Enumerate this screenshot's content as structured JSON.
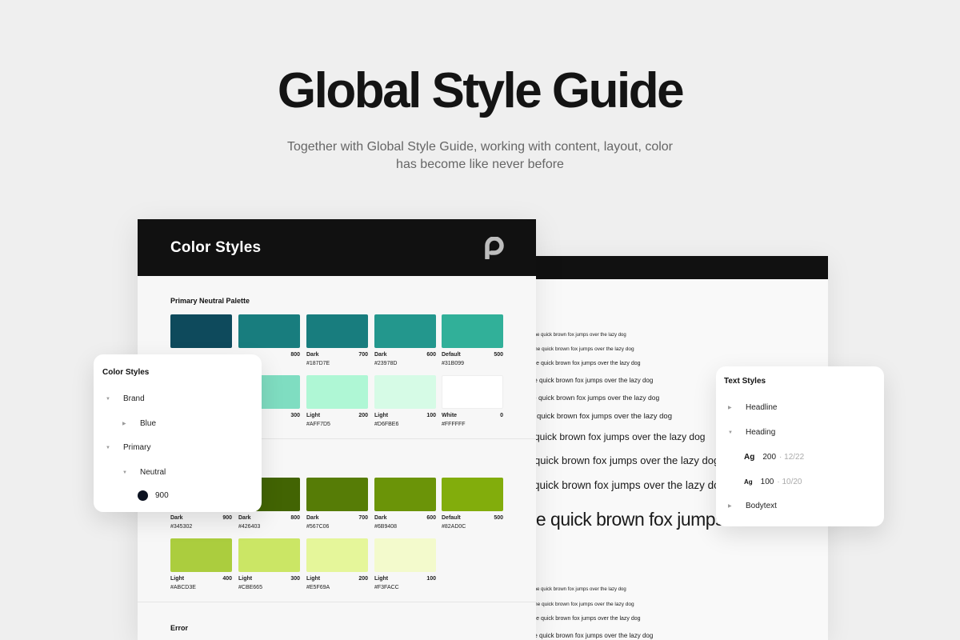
{
  "hero": {
    "title": "Global Style Guide",
    "subtitle_line1": "Together with Global Style Guide, working with content, layout, color",
    "subtitle_line2": "has become like never before"
  },
  "color_doc": {
    "title": "Color Styles",
    "logo_icon": "p-logo-icon",
    "primary_section": "Primary Neutral Palette",
    "error_section": "Error",
    "neutral_row1": [
      {
        "color": "#0E4A5C",
        "label": "",
        "weight": "",
        "hex": ""
      },
      {
        "color": "#187D7E",
        "label": "",
        "weight": "800",
        "hex": ""
      },
      {
        "color": "#187D7E",
        "label": "Dark",
        "weight": "700",
        "hex": "#187D7E"
      },
      {
        "color": "#23978D",
        "label": "Dark",
        "weight": "600",
        "hex": "#23978D"
      },
      {
        "color": "#31B099",
        "label": "Default",
        "weight": "500",
        "hex": "#31B099"
      }
    ],
    "neutral_row2": [
      {
        "color": "#7FDDC1",
        "label": "",
        "weight": "300",
        "hex": ""
      },
      {
        "color": "#AFF7D5",
        "label": "Light",
        "weight": "200",
        "hex": "#AFF7D5"
      },
      {
        "color": "#D6FBE6",
        "label": "Light",
        "weight": "100",
        "hex": "#D6FBE6"
      },
      {
        "color": "#FFFFFF",
        "label": "White",
        "weight": "0",
        "hex": "#FFFFFF"
      }
    ],
    "green_row1": [
      {
        "color": "#345302",
        "label": "Dark",
        "weight": "900",
        "hex": "#345302"
      },
      {
        "color": "#426403",
        "label": "Dark",
        "weight": "800",
        "hex": "#426403"
      },
      {
        "color": "#567C06",
        "label": "Dark",
        "weight": "700",
        "hex": "#567C06"
      },
      {
        "color": "#6B9408",
        "label": "Dark",
        "weight": "600",
        "hex": "#6B9408"
      },
      {
        "color": "#82AD0C",
        "label": "Default",
        "weight": "500",
        "hex": "#82AD0C"
      }
    ],
    "green_row2": [
      {
        "color": "#ABCD3E",
        "label": "Light",
        "weight": "400",
        "hex": "#ABCD3E"
      },
      {
        "color": "#CBE665",
        "label": "Light",
        "weight": "300",
        "hex": "#CBE665"
      },
      {
        "color": "#E5F69A",
        "label": "Light",
        "weight": "200",
        "hex": "#E5F69A"
      },
      {
        "color": "#F3FACC",
        "label": "Light",
        "weight": "100",
        "hex": "#F3FACC"
      }
    ]
  },
  "text_doc": {
    "sample_text": "The quick brown fox jumps over the lazy dog",
    "large_sample": "The quick brown fox jumps"
  },
  "color_panel": {
    "title": "Color Styles",
    "items": [
      {
        "label": "Brand",
        "caret": "▼"
      },
      {
        "label": "Blue",
        "caret": "▶"
      },
      {
        "label": "Primary",
        "caret": "▼"
      },
      {
        "label": "Neutral",
        "caret": "▼"
      },
      {
        "label": "900",
        "caret": ""
      }
    ]
  },
  "text_panel": {
    "title": "Text Styles",
    "headline": "Headline",
    "heading": "Heading",
    "ag": "Ag",
    "style_200": "200",
    "style_200_meta": "· 12/22",
    "style_100": "100",
    "style_100_meta": "· 10/20",
    "bodytext": "Bodytext"
  }
}
